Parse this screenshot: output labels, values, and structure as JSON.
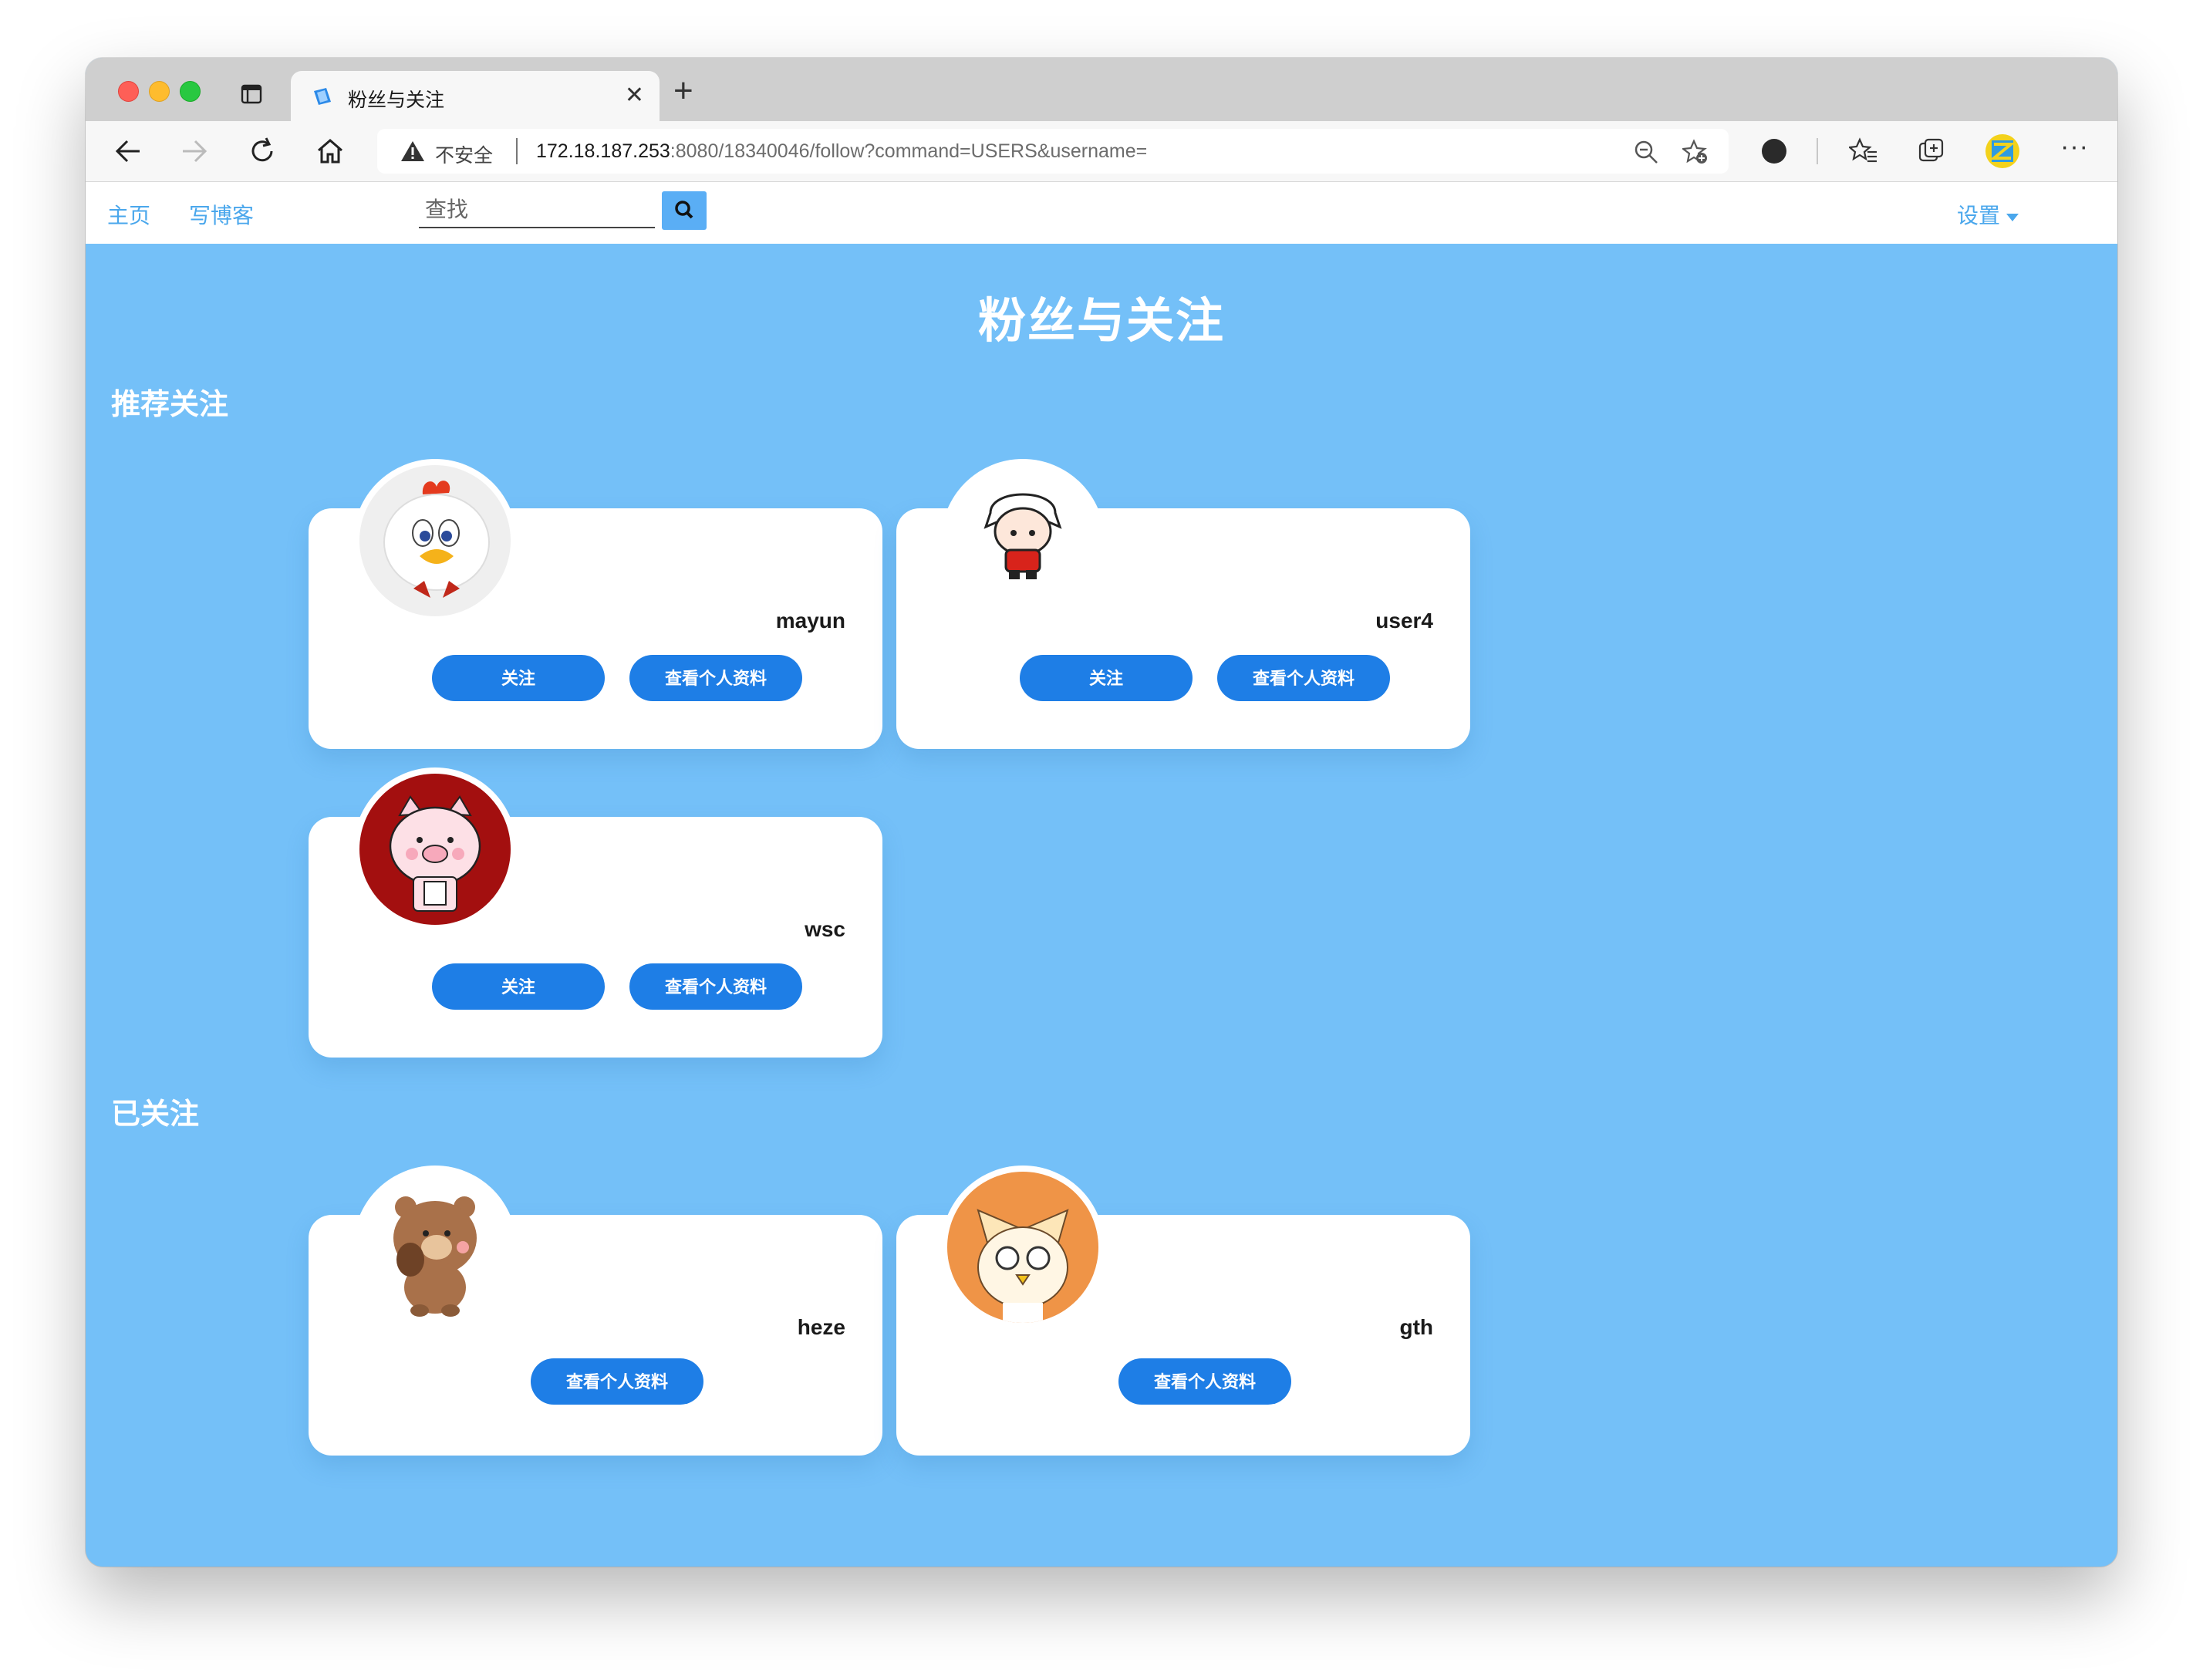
{
  "browser": {
    "tab_title": "粉丝与关注",
    "insecure_label": "不安全",
    "url_host": "172.18.187.253",
    "url_rest": ":8080/18340046/follow?command=USERS&username="
  },
  "nav": {
    "home": "主页",
    "write_blog": "写博客",
    "search_placeholder": "查找",
    "settings": "设置"
  },
  "page": {
    "title": "粉丝与关注",
    "recommend_heading": "推荐关注",
    "following_heading": "已关注"
  },
  "buttons": {
    "follow": "关注",
    "view_profile": "查看个人资料"
  },
  "recommended": [
    {
      "username": "mayun",
      "avatar": "chicken-avatar"
    },
    {
      "username": "user4",
      "avatar": "chibi-boy-avatar"
    },
    {
      "username": "wsc",
      "avatar": "pig-avatar"
    }
  ],
  "following": [
    {
      "username": "heze",
      "avatar": "bear-avatar"
    },
    {
      "username": "gth",
      "avatar": "cat-avatar"
    }
  ],
  "colors": {
    "page_bg": "#74c0f8",
    "button": "#1e7ee6",
    "nav_link": "#4aa7ec"
  }
}
